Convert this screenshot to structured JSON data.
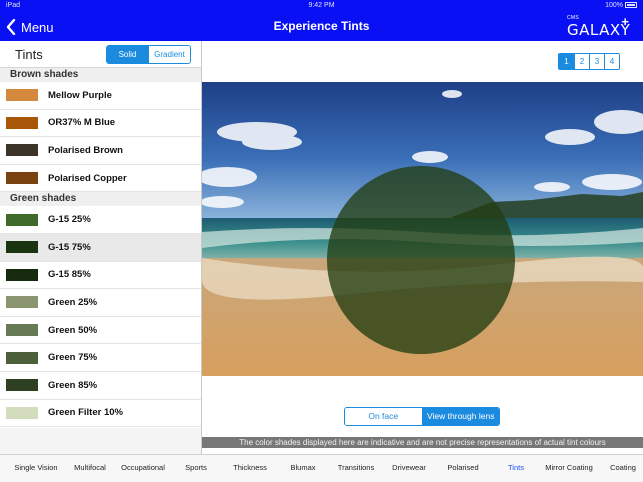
{
  "status_bar": {
    "carrier": "iPad",
    "time": "9:42 PM",
    "battery": "100%"
  },
  "nav": {
    "back_label": "Menu",
    "title": "Experience Tints",
    "brand_small": "CMS",
    "brand_name": "GALAXY",
    "brand_plus": "+"
  },
  "colors": {
    "nav_blue": "#0a10f4",
    "accent": "#1b8be0",
    "active_tab": "#1b4ff0"
  },
  "panel": {
    "title": "Tints",
    "mode_options": [
      "Solid",
      "Gradient"
    ],
    "mode_selected": "Solid"
  },
  "sections": [
    {
      "title": "Brown shades",
      "items": [
        {
          "name": "Mellow Purple",
          "color": "#d5893c"
        },
        {
          "name": "OR37% M Blue",
          "color": "#a85608"
        },
        {
          "name": "Polarised Brown",
          "color": "#3c3429"
        },
        {
          "name": "Polarised Copper",
          "color": "#7a4111"
        }
      ]
    },
    {
      "title": "Green shades",
      "items": [
        {
          "name": "G-15 25%",
          "color": "#3e6b2b"
        },
        {
          "name": "G-15 75%",
          "color": "#1b3410",
          "selected": true
        },
        {
          "name": "G-15 85%",
          "color": "#152a0f"
        },
        {
          "name": "Green 25%",
          "color": "#8a9570"
        },
        {
          "name": "Green 50%",
          "color": "#687a55"
        },
        {
          "name": "Green 75%",
          "color": "#4d5f3a"
        },
        {
          "name": "Green 85%",
          "color": "#2e3f22"
        },
        {
          "name": "Green Filter 10%",
          "color": "#d3dbbd"
        }
      ]
    }
  ],
  "pager": {
    "pages": [
      "1",
      "2",
      "3",
      "4"
    ],
    "active": "1"
  },
  "view_toggle": {
    "options": [
      "On face",
      "View through lens"
    ],
    "selected": "View through lens"
  },
  "disclaimer": "The color shades displayed here are indicative and are not precise representations of actual tint colours",
  "tabs": [
    "Single Vision",
    "Multifocal",
    "Occupational",
    "Sports",
    "Thickness",
    "Blumax",
    "Transitions",
    "Drivewear",
    "Polarised",
    "Tints",
    "Mirror Coating",
    "Coating"
  ],
  "active_tab": "Tints"
}
